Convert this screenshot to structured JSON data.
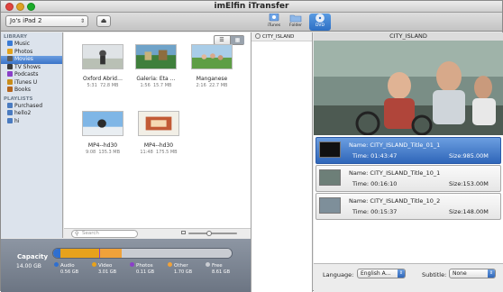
{
  "window": {
    "title": "imElfin   iTransfer"
  },
  "toolbar": {
    "device": "Jo's iPad 2",
    "buttons": [
      {
        "label": "iTunes",
        "icon": "itunes-icon"
      },
      {
        "label": "Folder",
        "icon": "folder-icon"
      },
      {
        "label": "DVD",
        "icon": "dvd-icon"
      }
    ]
  },
  "sidebar": {
    "library_header": "LIBRARY",
    "library": [
      {
        "label": "Music",
        "icon": "music-icon",
        "color": "#3a7bd5"
      },
      {
        "label": "Photos",
        "icon": "photos-icon",
        "color": "#e3a21a"
      },
      {
        "label": "Movies",
        "icon": "movies-icon",
        "color": "#5a5a5a",
        "selected": true
      },
      {
        "label": "TV Shows",
        "icon": "tv-icon",
        "color": "#3b3b3b"
      },
      {
        "label": "Podcasts",
        "icon": "podcast-icon",
        "color": "#8a3fc8"
      },
      {
        "label": "iTunes U",
        "icon": "itunes-u-icon",
        "color": "#c98d1a"
      },
      {
        "label": "Books",
        "icon": "books-icon",
        "color": "#b5651d"
      }
    ],
    "playlists_header": "PLAYLISTS",
    "playlists": [
      {
        "label": "Purchased",
        "icon": "playlist-icon",
        "color": "#4a7bc0"
      },
      {
        "label": "hello2",
        "icon": "playlist-icon",
        "color": "#4a7bc0"
      },
      {
        "label": "hi",
        "icon": "playlist-icon",
        "color": "#4a7bc0"
      }
    ]
  },
  "movies": [
    {
      "name": "Oxford Abrid…",
      "duration": "5:31",
      "size": "72.8 MB"
    },
    {
      "name": "Galeria: Eta …",
      "duration": "1:56",
      "size": "15.7 MB"
    },
    {
      "name": "Manganese",
      "duration": "2:16",
      "size": "22.7 MB"
    },
    {
      "name": "MP4--hd30",
      "duration": "9:08",
      "size": "135.3 MB"
    },
    {
      "name": "MP4--hd30",
      "duration": "11:48",
      "size": "175.5 MB"
    }
  ],
  "search": {
    "placeholder": "Search"
  },
  "zoom_level": 0.4,
  "capacity": {
    "label": "Capacity",
    "total": "14.00 GB",
    "segments": [
      {
        "name": "Audio",
        "value": "0.56 GB",
        "gb": 0.56,
        "color": "#2f6fd0"
      },
      {
        "name": "Video",
        "value": "3.01 GB",
        "gb": 3.01,
        "color": "#e7a21c"
      },
      {
        "name": "Photos",
        "value": "0.11 GB",
        "gb": 0.11,
        "color": "#8b3fc9"
      },
      {
        "name": "Other",
        "value": "1.70 GB",
        "gb": 1.7,
        "color": "#f0a23a"
      },
      {
        "name": "Free",
        "value": "8.61 GB",
        "gb": 8.61,
        "color": "#c9ccd2"
      }
    ]
  },
  "dvd": {
    "source": "CITY_ISLAND",
    "preview_title": "CITY_ISLAND",
    "titles": [
      {
        "name": "Name: CITY_ISLAND_Title_01_1",
        "time": "Time: 01:43:47",
        "size": "Size:985.00M",
        "selected": true
      },
      {
        "name": "Name: CITY_ISLAND_Title_10_1",
        "time": "Time: 00:16:10",
        "size": "Size:153.00M",
        "selected": false
      },
      {
        "name": "Name: CITY_ISLAND_Title_10_2",
        "time": "Time: 00:15:37",
        "size": "Size:148.00M",
        "selected": false
      }
    ],
    "language_label": "Language:",
    "language_value": "English A…",
    "subtitle_label": "Subtitle:",
    "subtitle_value": "None"
  }
}
